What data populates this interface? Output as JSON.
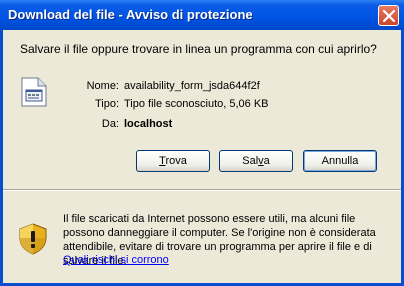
{
  "window": {
    "title": "Download del file - Avviso di protezione"
  },
  "dialog": {
    "question": "Salvare il file oppure trovare in linea un programma con cui aprirlo?",
    "file": {
      "name_label": "Nome:",
      "name_value": "availability_form_jsda644f2f",
      "type_label": "Tipo:",
      "type_value": "Tipo file sconosciuto, 5,06 KB",
      "from_label": "Da:",
      "from_value": "localhost"
    },
    "buttons": {
      "find_prefix": "",
      "find_accel": "T",
      "find_rest": "rova",
      "save_prefix": "Sal",
      "save_accel": "v",
      "save_rest": "a",
      "cancel_label": "Annulla"
    },
    "warning": {
      "text": "Il file scaricati da Internet possono essere utili, ma alcuni file possono danneggiare il computer. Se l'origine non è considerata attendibile, evitare di trovare un programma per aprire il file e di salvare il file.",
      "link": "Quali rischi si corrono"
    },
    "icons": {
      "file": "unknown-file-icon",
      "warning": "security-shield-icon",
      "close": "close-icon"
    },
    "colors": {
      "titlebar": "#0054E3",
      "dialog_bg": "#ECE9D8",
      "close_button": "#C8452A",
      "link": "#0000FF"
    }
  }
}
